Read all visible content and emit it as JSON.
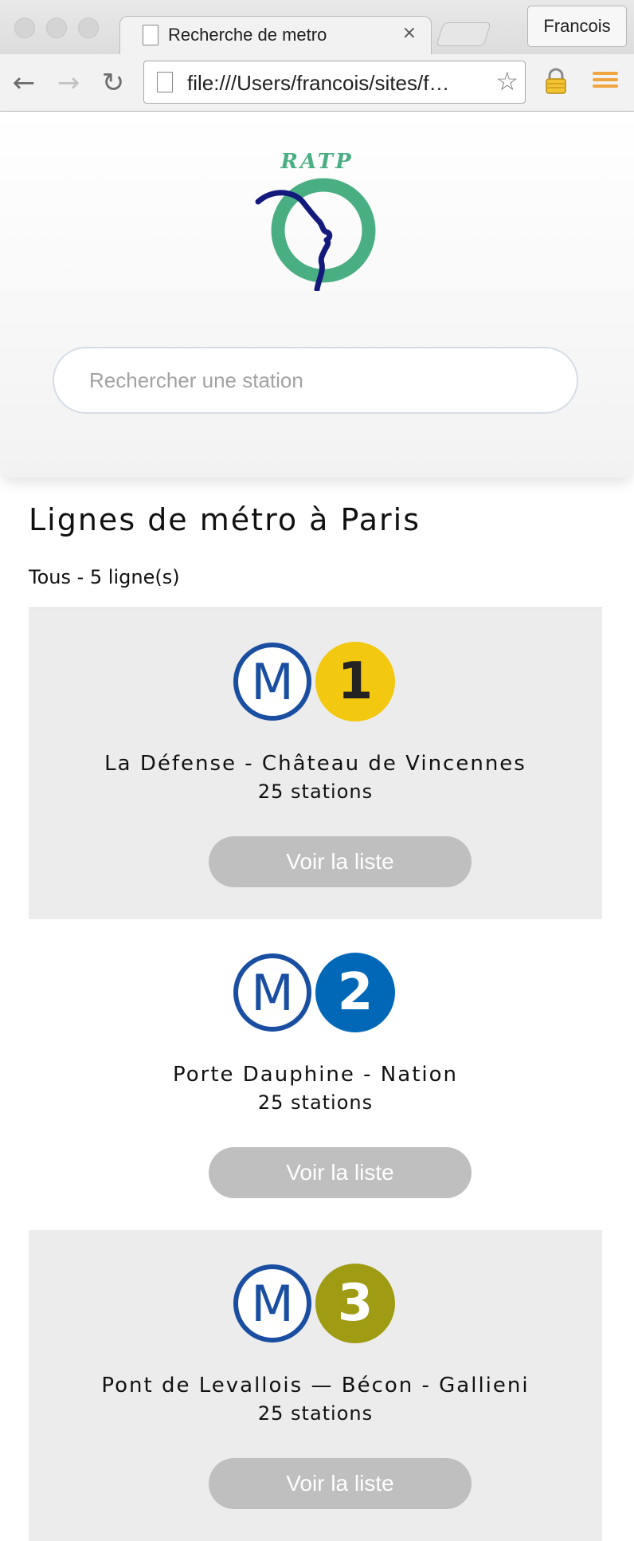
{
  "browser": {
    "tab_title": "Recherche de metro",
    "tab_close": "×",
    "profile_name": "Francois",
    "url": "file:///Users/francois/sites/f…",
    "back_glyph": "←",
    "forward_glyph": "→",
    "reload_glyph": "↻",
    "star_glyph": "☆"
  },
  "header": {
    "logo_text": "RATP",
    "search_placeholder": "Rechercher une station"
  },
  "main": {
    "title": "Lignes de métro à Paris",
    "filter_summary": "Tous - 5 ligne(s)",
    "lines": [
      {
        "number": "1",
        "color": "#f2c811",
        "number_color": "#222222",
        "route": "La Défense - Château de Vincennes",
        "stations": "25 stations",
        "button": "Voir la liste"
      },
      {
        "number": "2",
        "color": "#0068b7",
        "number_color": "#ffffff",
        "route": "Porte Dauphine - Nation",
        "stations": "25 stations",
        "button": "Voir la liste"
      },
      {
        "number": "3",
        "color": "#9f9b12",
        "number_color": "#ffffff",
        "route": "Pont de Levallois — Bécon - Gallieni",
        "stations": "25 stations",
        "button": "Voir la liste"
      }
    ]
  },
  "colors": {
    "metro_blue": "#1a4ea1",
    "ratp_green": "#4aae83",
    "ratp_navy": "#141a7c",
    "button_grey": "#bfbfbf"
  }
}
